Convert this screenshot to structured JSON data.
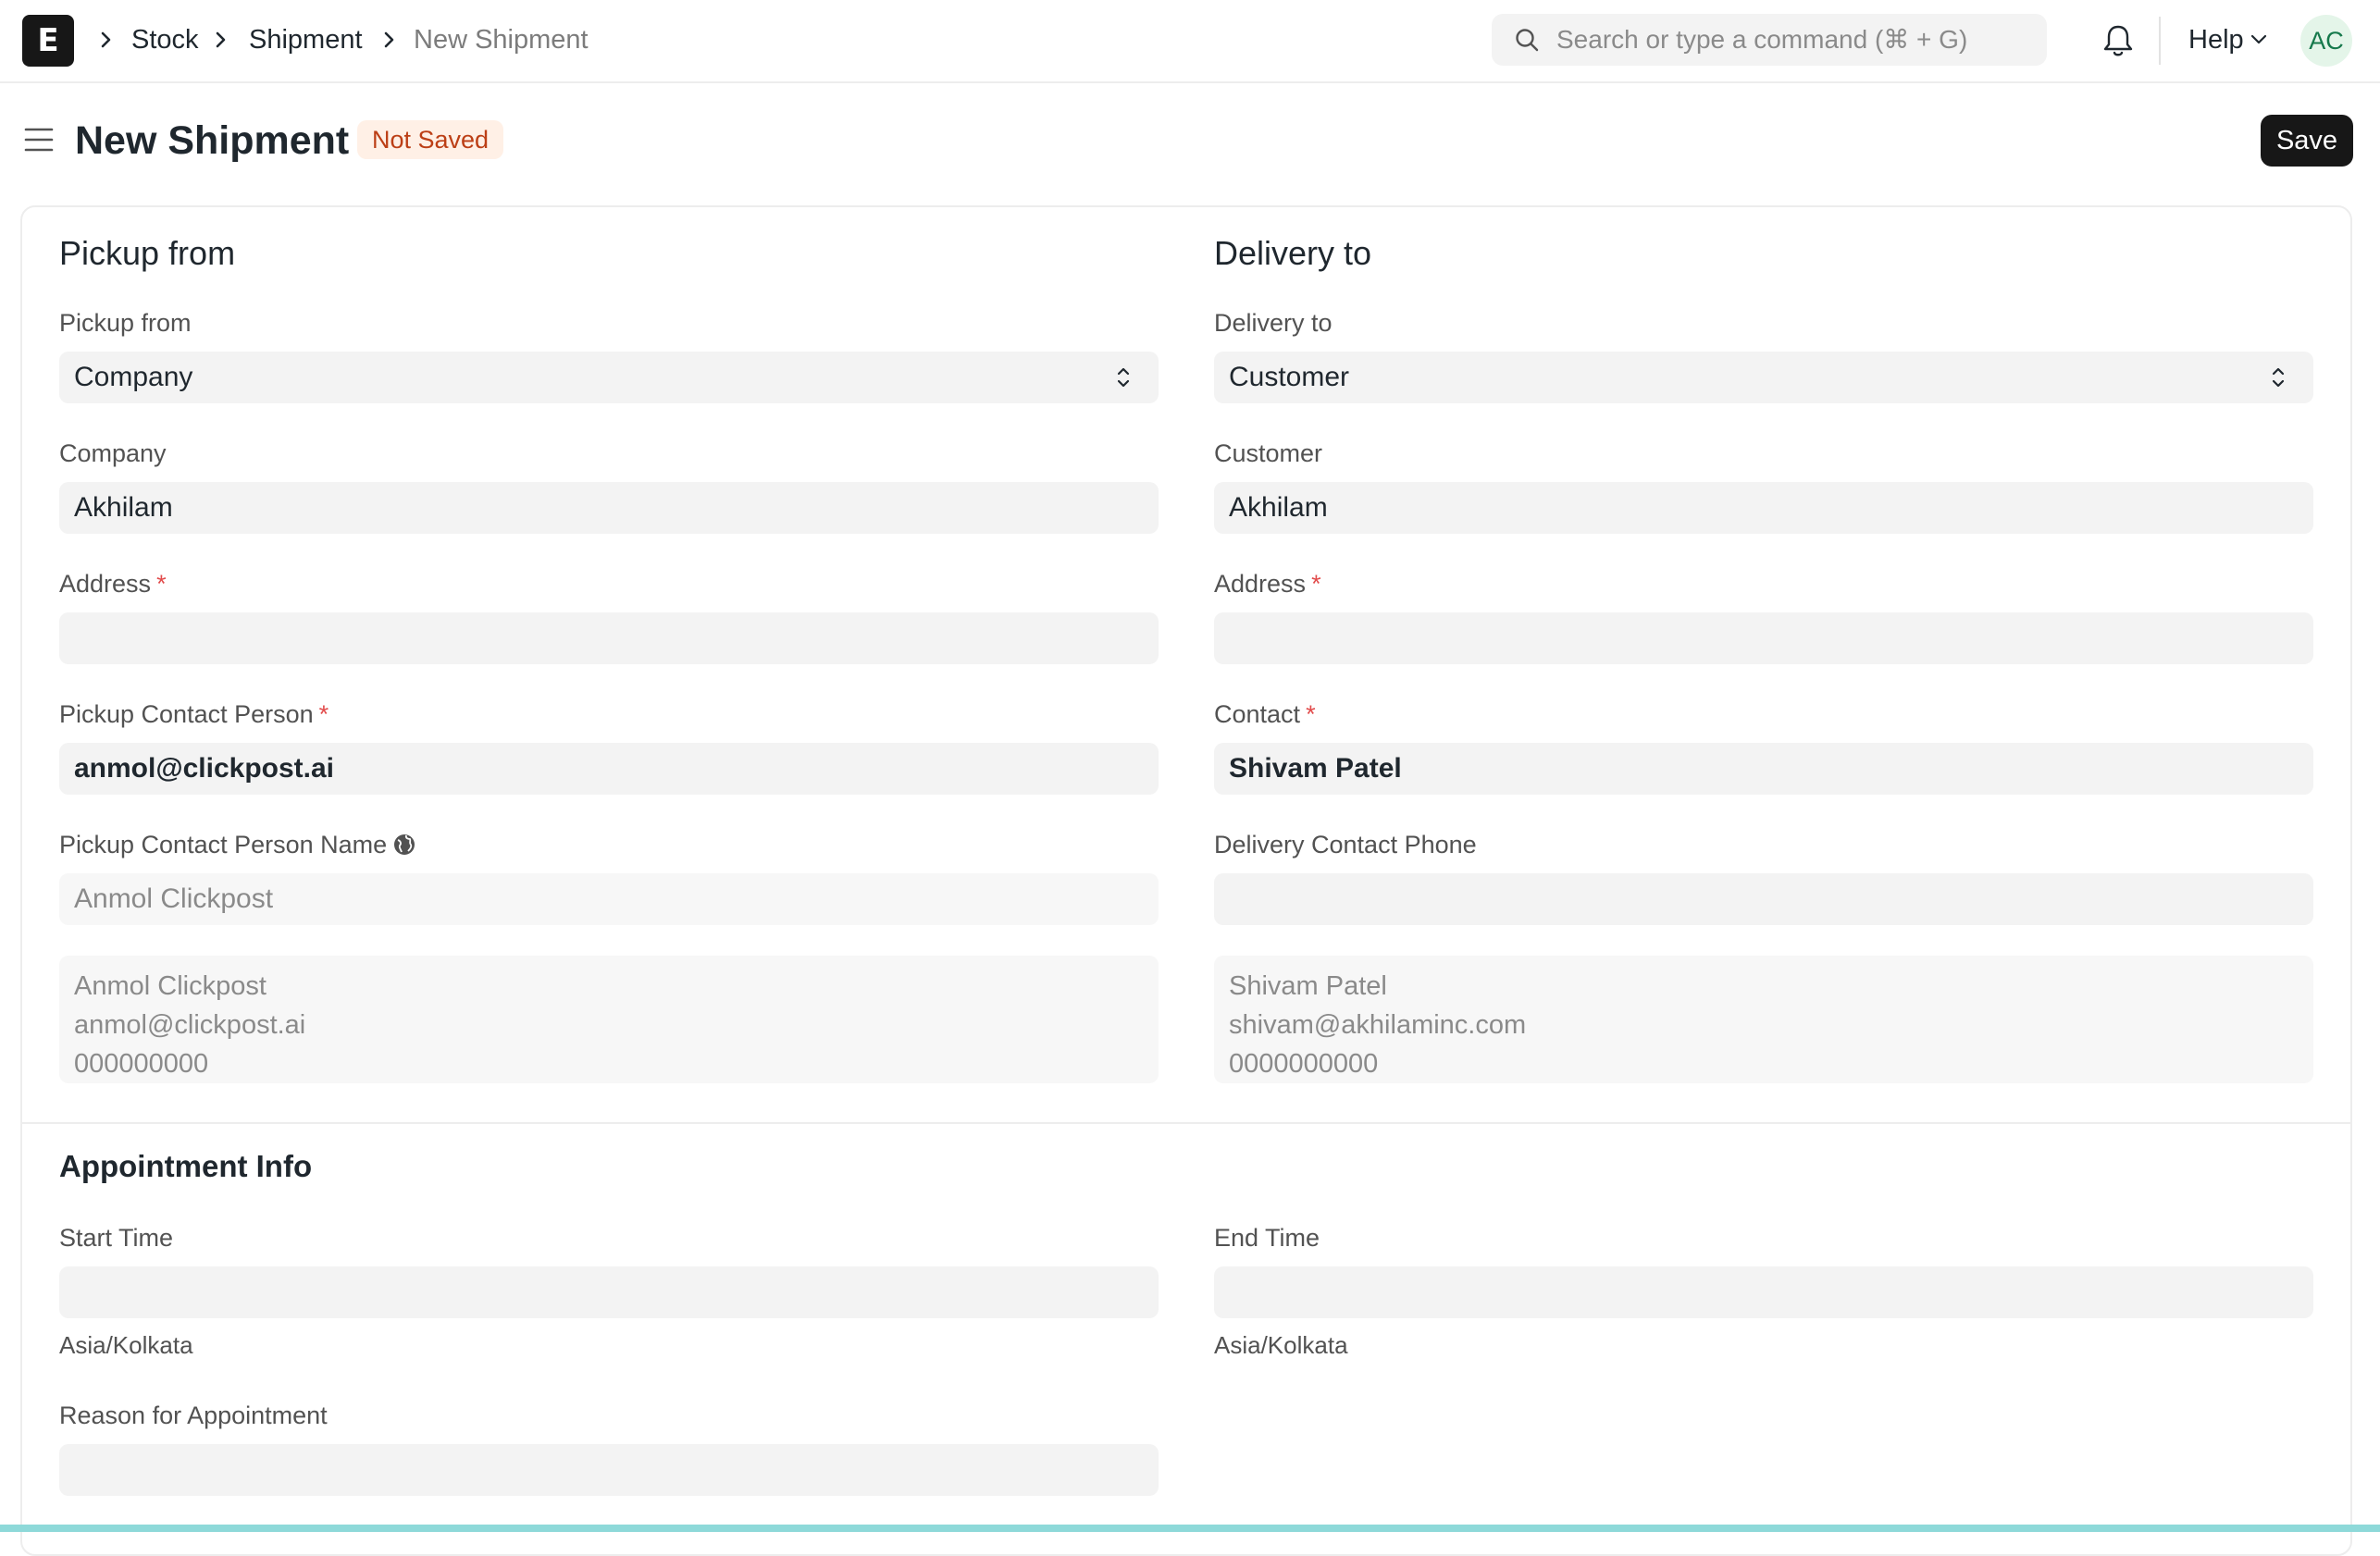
{
  "navbar": {
    "logo": "E",
    "breadcrumbs": [
      "Stock",
      "Shipment",
      "New Shipment"
    ],
    "search_placeholder": "Search or type a command (⌘ + G)",
    "help_label": "Help",
    "avatar_initials": "AC"
  },
  "page": {
    "title": "New Shipment",
    "status_badge": "Not Saved",
    "save_label": "Save"
  },
  "pickup": {
    "section_title": "Pickup from",
    "type_label": "Pickup from",
    "type_value": "Company",
    "company_label": "Company",
    "company_value": "Akhilam",
    "address_label": "Address",
    "address_value": "",
    "contact_label": "Pickup Contact Person",
    "contact_value": "anmol@clickpost.ai",
    "contact_name_label": "Pickup Contact Person Name",
    "contact_name_value": "Anmol Clickpost",
    "contact_details": [
      "Anmol Clickpost",
      "anmol@clickpost.ai",
      "000000000"
    ]
  },
  "delivery": {
    "section_title": "Delivery to",
    "type_label": "Delivery to",
    "type_value": "Customer",
    "customer_label": "Customer",
    "customer_value": "Akhilam",
    "address_label": "Address",
    "address_value": "",
    "contact_label": "Contact",
    "contact_value": "Shivam Patel",
    "phone_label": "Delivery Contact Phone",
    "phone_value": "",
    "contact_details": [
      "Shivam Patel",
      "shivam@akhilaminc.com",
      "0000000000"
    ]
  },
  "appointment": {
    "section_title": "Appointment Info",
    "start_label": "Start Time",
    "start_value": "",
    "start_tz": "Asia/Kolkata",
    "end_label": "End Time",
    "end_value": "",
    "end_tz": "Asia/Kolkata",
    "reason_label": "Reason for Appointment",
    "reason_value": ""
  },
  "required_marker": "*",
  "colors": {
    "accent_dark": "#171717",
    "badge_bg": "#fff0e6",
    "badge_text": "#bc3f16",
    "required": "#e24c4c",
    "field_bg": "#f3f3f3"
  }
}
